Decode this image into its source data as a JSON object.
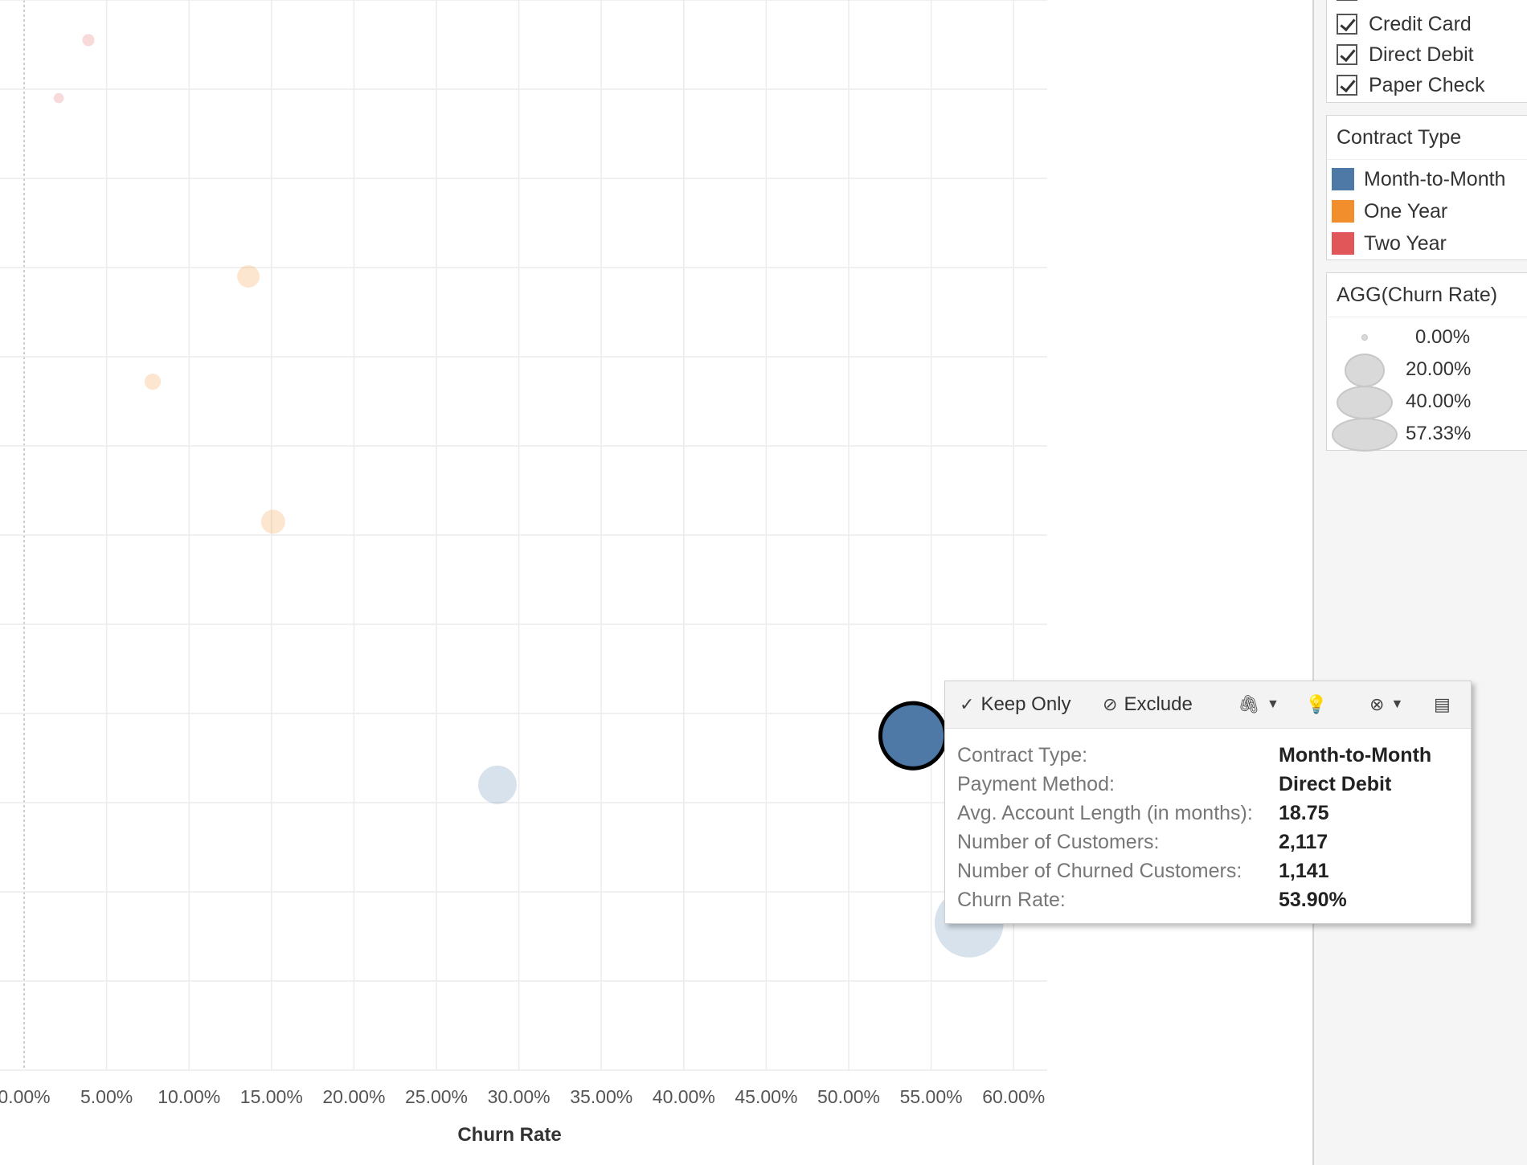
{
  "chart_data": {
    "type": "scatter",
    "xlabel": "Churn Rate",
    "xticks": [
      "0.00%",
      "5.00%",
      "10.00%",
      "15.00%",
      "20.00%",
      "25.00%",
      "30.00%",
      "35.00%",
      "40.00%",
      "45.00%",
      "50.00%",
      "55.00%",
      "60.00%"
    ],
    "xlim": [
      0,
      62
    ],
    "ylim": [
      0,
      12
    ],
    "grid": true,
    "size_encoding": "AGG(Churn Rate)",
    "points": [
      {
        "contract": "Two Year",
        "x": 3.9,
        "y": 11.55,
        "size": 3.9
      },
      {
        "contract": "Two Year",
        "x": 2.1,
        "y": 10.9,
        "size": 2.1
      },
      {
        "contract": "One Year",
        "x": 13.6,
        "y": 8.9,
        "size": 13.6
      },
      {
        "contract": "One Year",
        "x": 7.8,
        "y": 7.72,
        "size": 7.8
      },
      {
        "contract": "One Year",
        "x": 15.1,
        "y": 6.15,
        "size": 15.1
      },
      {
        "contract": "Month-to-Month",
        "x": 53.9,
        "y": 3.75,
        "size": 53.9,
        "selected": true
      },
      {
        "contract": "Month-to-Month",
        "x": 28.7,
        "y": 3.2,
        "size": 28.7
      },
      {
        "contract": "Month-to-Month",
        "x": 57.3,
        "y": 1.65,
        "size": 57.3
      }
    ]
  },
  "filter_card": {
    "items": [
      {
        "label": "Credit Card",
        "checked": true
      },
      {
        "label": "Direct Debit",
        "checked": true
      },
      {
        "label": "Paper Check",
        "checked": true
      }
    ]
  },
  "color_legend": {
    "title": "Contract Type",
    "items": [
      {
        "label": "Month-to-Month",
        "color": "#4e79a7"
      },
      {
        "label": "One Year",
        "color": "#f28e2b"
      },
      {
        "label": "Two Year",
        "color": "#e15759"
      }
    ]
  },
  "size_legend": {
    "title": "AGG(Churn Rate)",
    "items": [
      {
        "label": "0.00%",
        "value": 0
      },
      {
        "label": "20.00%",
        "value": 20
      },
      {
        "label": "40.00%",
        "value": 40
      },
      {
        "label": "57.33%",
        "value": 57.33
      }
    ]
  },
  "tooltip": {
    "actions": {
      "keep_only": "Keep Only",
      "exclude": "Exclude"
    },
    "rows": [
      {
        "key": "Contract Type:",
        "value": "Month-to-Month"
      },
      {
        "key": "Payment Method:",
        "value": "Direct Debit"
      },
      {
        "key": "Avg. Account Length (in months):",
        "value": "18.75"
      },
      {
        "key": "Number of Customers:",
        "value": "2,117"
      },
      {
        "key": "Number of Churned Customers:",
        "value": "1,141"
      },
      {
        "key": "Churn Rate:",
        "value": "53.90%"
      }
    ]
  }
}
